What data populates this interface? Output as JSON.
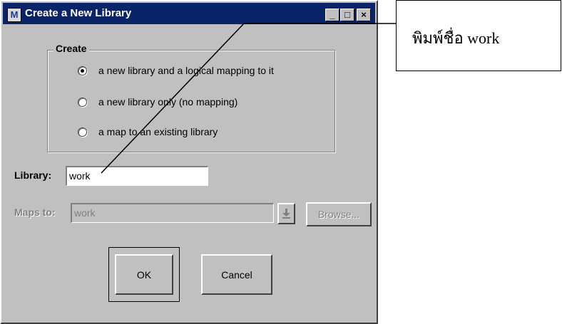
{
  "window": {
    "title": "Create a New Library",
    "app_icon_glyph": "M",
    "controls": {
      "minimize": "_",
      "maximize": "□",
      "close": "×"
    }
  },
  "create_group": {
    "legend": "Create",
    "options": [
      {
        "label": "a new library and a logical mapping to it",
        "selected": true
      },
      {
        "label": "a new library only (no mapping)",
        "selected": false
      },
      {
        "label": "a map to an existing library",
        "selected": false
      }
    ]
  },
  "library": {
    "label": "Library:",
    "value": "work"
  },
  "maps_to": {
    "label": "Maps to:",
    "value": "work",
    "dropdown_icon": "download-arrow-icon",
    "browse_label": "Browse..."
  },
  "buttons": {
    "ok": "OK",
    "cancel": "Cancel"
  },
  "callout": {
    "text": "พิมพ์ชื่อ work"
  },
  "colors": {
    "titlebar": "#0a246a",
    "dialog": "#c0c0c0",
    "disabled_text": "#808080"
  }
}
